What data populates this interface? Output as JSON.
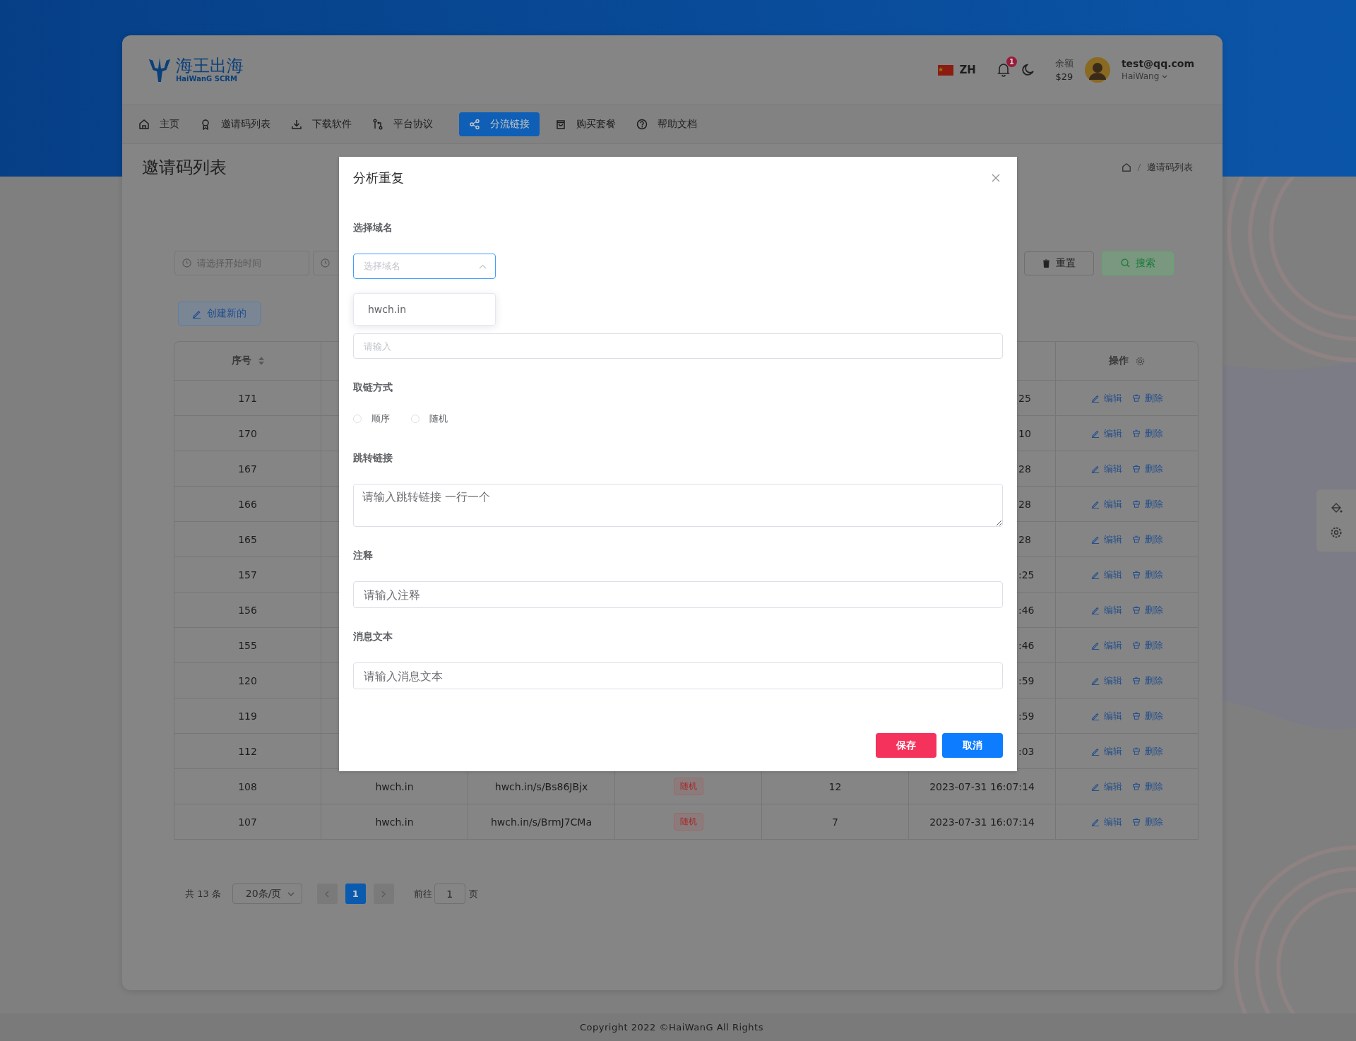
{
  "header": {
    "logo": {
      "name": "海王出海",
      "subtitle": "HaiWanG SCRM"
    },
    "language": "ZH",
    "notification_count": "1",
    "balance_label": "余额",
    "balance": "$29",
    "user": {
      "email": "test@qq.com",
      "name": "HaiWang"
    }
  },
  "nav": [
    {
      "label": "主页",
      "selected": false
    },
    {
      "label": "邀请码列表",
      "selected": false
    },
    {
      "label": "下载软件",
      "selected": false
    },
    {
      "label": "平台协议",
      "selected": false
    },
    {
      "label": "分流链接",
      "selected": true
    },
    {
      "label": "购买套餐",
      "selected": false
    },
    {
      "label": "帮助文档",
      "selected": false
    }
  ],
  "page_title": "邀请码列表",
  "breadcrumb": [
    "邀请码列表"
  ],
  "filters": {
    "start_placeholder": "请选择开始时间",
    "reset": "重置",
    "search": "搜索"
  },
  "create_button": "创建新的",
  "table": {
    "columns": [
      {
        "label": "序号"
      },
      {
        "label": "操作"
      }
    ],
    "rows": [
      {
        "id": "171",
        "time": "25",
        "edit": "编辑",
        "delete": "删除"
      },
      {
        "id": "170",
        "time": "10",
        "edit": "编辑",
        "delete": "删除"
      },
      {
        "id": "167",
        "time": "28",
        "edit": "编辑",
        "delete": "删除"
      },
      {
        "id": "166",
        "time": "28",
        "edit": "编辑",
        "delete": "删除"
      },
      {
        "id": "165",
        "time": "28",
        "edit": "编辑",
        "delete": "删除"
      },
      {
        "id": "157",
        "time": ":25",
        "edit": "编辑",
        "delete": "删除"
      },
      {
        "id": "156",
        "time": ":46",
        "edit": "编辑",
        "delete": "删除"
      },
      {
        "id": "155",
        "time": ":46",
        "edit": "编辑",
        "delete": "删除"
      },
      {
        "id": "120",
        "time": ":59",
        "edit": "编辑",
        "delete": "删除"
      },
      {
        "id": "119",
        "time": ":59",
        "edit": "编辑",
        "delete": "删除"
      },
      {
        "id": "112",
        "time": ":03",
        "edit": "编辑",
        "delete": "删除"
      },
      {
        "id": "108",
        "domain": "hwch.in",
        "link": "hwch.in/s/Bs86JBjx",
        "mode": "随机",
        "count": "12",
        "time": "2023-07-31 16:07:14",
        "edit": "编辑",
        "delete": "删除"
      },
      {
        "id": "107",
        "domain": "hwch.in",
        "link": "hwch.in/s/BrmJ7CMa",
        "mode": "随机",
        "count": "7",
        "time": "2023-07-31 16:07:14",
        "edit": "编辑",
        "delete": "删除"
      }
    ]
  },
  "pagination": {
    "total": "共 13 条",
    "page_size": "20条/页",
    "pages": [
      {
        "label": "1",
        "selected": true
      }
    ],
    "goto_label": "前往",
    "goto_value": "1",
    "page_suffix": "页"
  },
  "footer": "Copyright 2022 ©HaiWanG All Rights",
  "modal": {
    "title": "分析重复",
    "fields": [
      {
        "kind": "select",
        "label": "选择域名",
        "placeholder": "选择域名",
        "expanded": true,
        "options": [
          "hwch.in"
        ]
      },
      {
        "kind": "input",
        "placeholder": "请输入"
      },
      {
        "kind": "radio",
        "label": "取链方式",
        "options": [
          {
            "label": "顺序",
            "selected": false
          },
          {
            "label": "随机",
            "selected": false
          }
        ]
      },
      {
        "kind": "textarea",
        "label": "跳转链接",
        "placeholder": "请输入跳转链接 一行一个"
      },
      {
        "kind": "input",
        "label": "注释",
        "placeholder": "请输入注释"
      },
      {
        "kind": "input",
        "label": "消息文本",
        "placeholder": "请输入消息文本"
      }
    ],
    "buttons": [
      {
        "label": "保存",
        "kind": "danger"
      },
      {
        "label": "取消",
        "kind": "primary"
      }
    ]
  }
}
